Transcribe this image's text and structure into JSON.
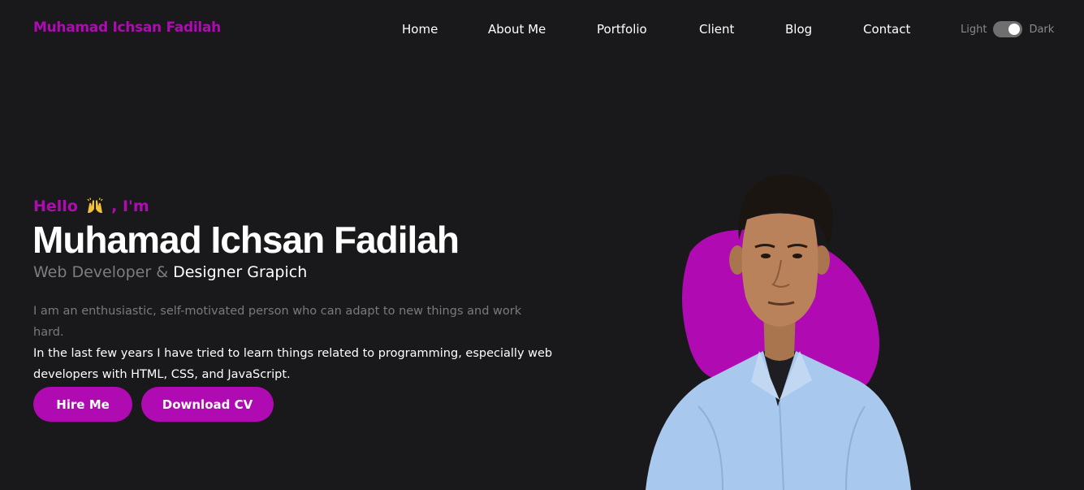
{
  "header": {
    "brand": "Muhamad Ichsan Fadilah",
    "nav": [
      "Home",
      "About Me",
      "Portfolio",
      "Client",
      "Blog",
      "Contact"
    ],
    "theme": {
      "light_label": "Light",
      "dark_label": "Dark",
      "selected": "Dark"
    }
  },
  "hero": {
    "greeting_prefix": "Hello",
    "greeting_suffix": ", I'm",
    "greeting_icon": "raising-hands-icon",
    "name": "Muhamad Ichsan Fadilah",
    "role_muted": "Web Developer &",
    "role_highlight": "Designer Grapich",
    "description_line1": "I am an enthusiastic, self-motivated person who can adapt to new things and work hard.",
    "description_line2": "In the last few years I have tried to learn things related to programming, especially web developers with HTML, CSS, and JavaScript.",
    "buttons": {
      "hire": "Hire Me",
      "cv": "Download CV"
    }
  },
  "colors": {
    "background": "#19191b",
    "accent": "#b00ab3",
    "text": "#ffffff",
    "muted_text": "#7d7d7d",
    "shirt": "#a9c8ee"
  }
}
